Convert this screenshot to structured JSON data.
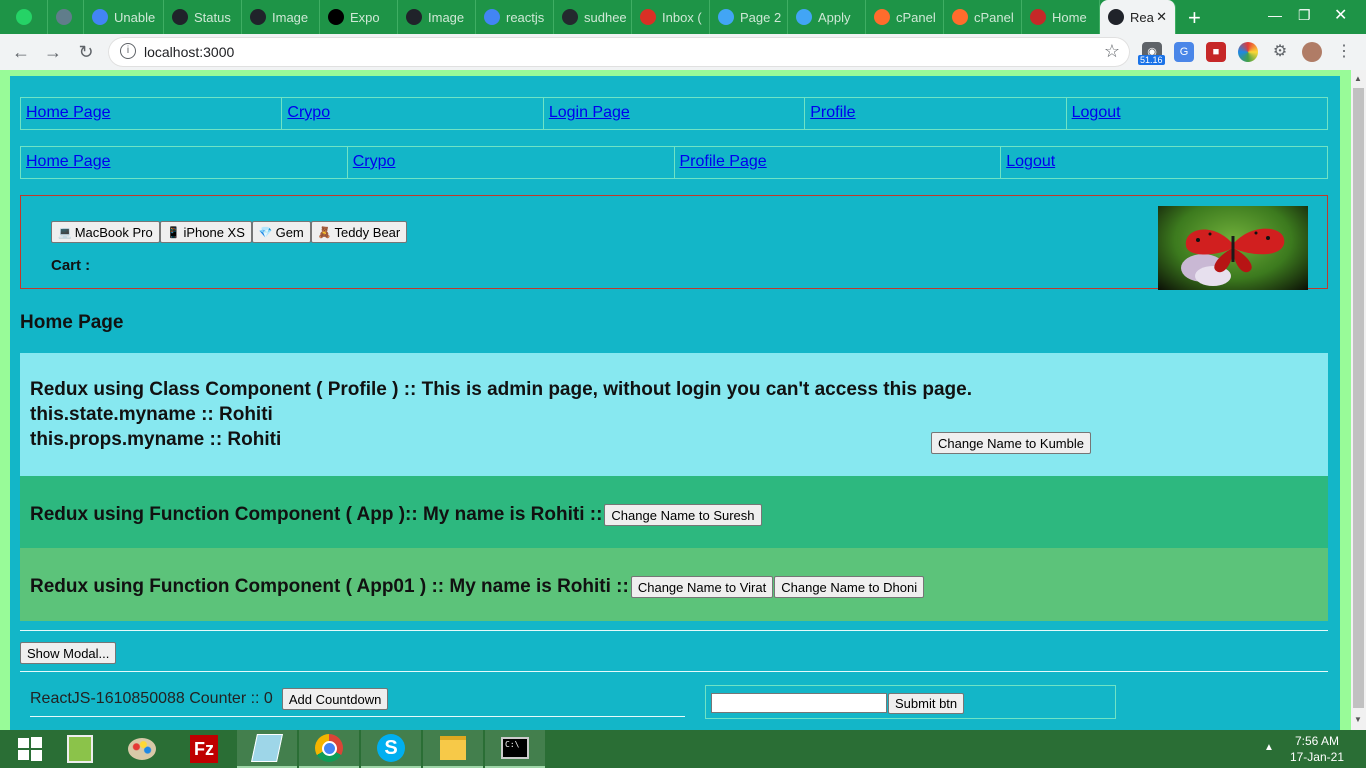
{
  "browser": {
    "tabs": [
      {
        "label": "",
        "icon": "whatsapp-icon"
      },
      {
        "label": "",
        "icon": "settings-icon"
      },
      {
        "label": "Unable",
        "icon": "google-icon"
      },
      {
        "label": "Status",
        "icon": "react-icon"
      },
      {
        "label": "Image",
        "icon": "react-icon"
      },
      {
        "label": "Expo",
        "icon": "expo-icon"
      },
      {
        "label": "Image",
        "icon": "react-icon"
      },
      {
        "label": "reactjs",
        "icon": "google-icon"
      },
      {
        "label": "sudhee",
        "icon": "github-icon"
      },
      {
        "label": "Inbox (",
        "icon": "gmail-icon"
      },
      {
        "label": "Page 2",
        "icon": "flutter-icon"
      },
      {
        "label": "Apply",
        "icon": "flutter-icon"
      },
      {
        "label": "cPanel",
        "icon": "cpanel-icon"
      },
      {
        "label": "cPanel",
        "icon": "cpanel-icon"
      },
      {
        "label": "Home",
        "icon": "chart-icon"
      },
      {
        "label": "Rea",
        "icon": "react-icon"
      }
    ],
    "url": "localhost:3000",
    "ext_badge": "51.16"
  },
  "nav1": [
    "Home Page",
    "Crypo",
    "Login Page",
    "Profile",
    "Logout"
  ],
  "nav2": [
    "Home Page",
    "Crypo",
    "Profile Page",
    "Logout"
  ],
  "shop": {
    "products": [
      {
        "icon": "💻",
        "label": "MacBook Pro"
      },
      {
        "icon": "📱",
        "label": "iPhone XS"
      },
      {
        "icon": "💎",
        "label": "Gem"
      },
      {
        "icon": "🧸",
        "label": "Teddy Bear"
      }
    ],
    "cart_label": "Cart :"
  },
  "page_heading": "Home Page",
  "profile_block": {
    "line1": "Redux using Class Component ( Profile ) :: This is admin page, without login you can't access this page.",
    "line2": "this.state.myname :: Rohiti",
    "line3": "this.props.myname :: Rohiti",
    "button": "Change Name to Kumble"
  },
  "app_block": {
    "text": "Redux using Function Component ( App ):: My name is Rohiti ::",
    "button": "Change Name to Suresh"
  },
  "app01_block": {
    "text": "Redux using Function Component ( App01 ) :: My name is Rohiti ::",
    "button1": "Change Name to Virat",
    "button2": "Change Name to Dhoni"
  },
  "modal_button": "Show Modal...",
  "counter": {
    "text": "ReactJS-1610850088 Counter :: 0",
    "button": "Add Countdown"
  },
  "form": {
    "input_value": "",
    "submit": "Submit btn"
  },
  "taskbar": {
    "time": "7:56 AM",
    "date": "17-Jan-21"
  }
}
